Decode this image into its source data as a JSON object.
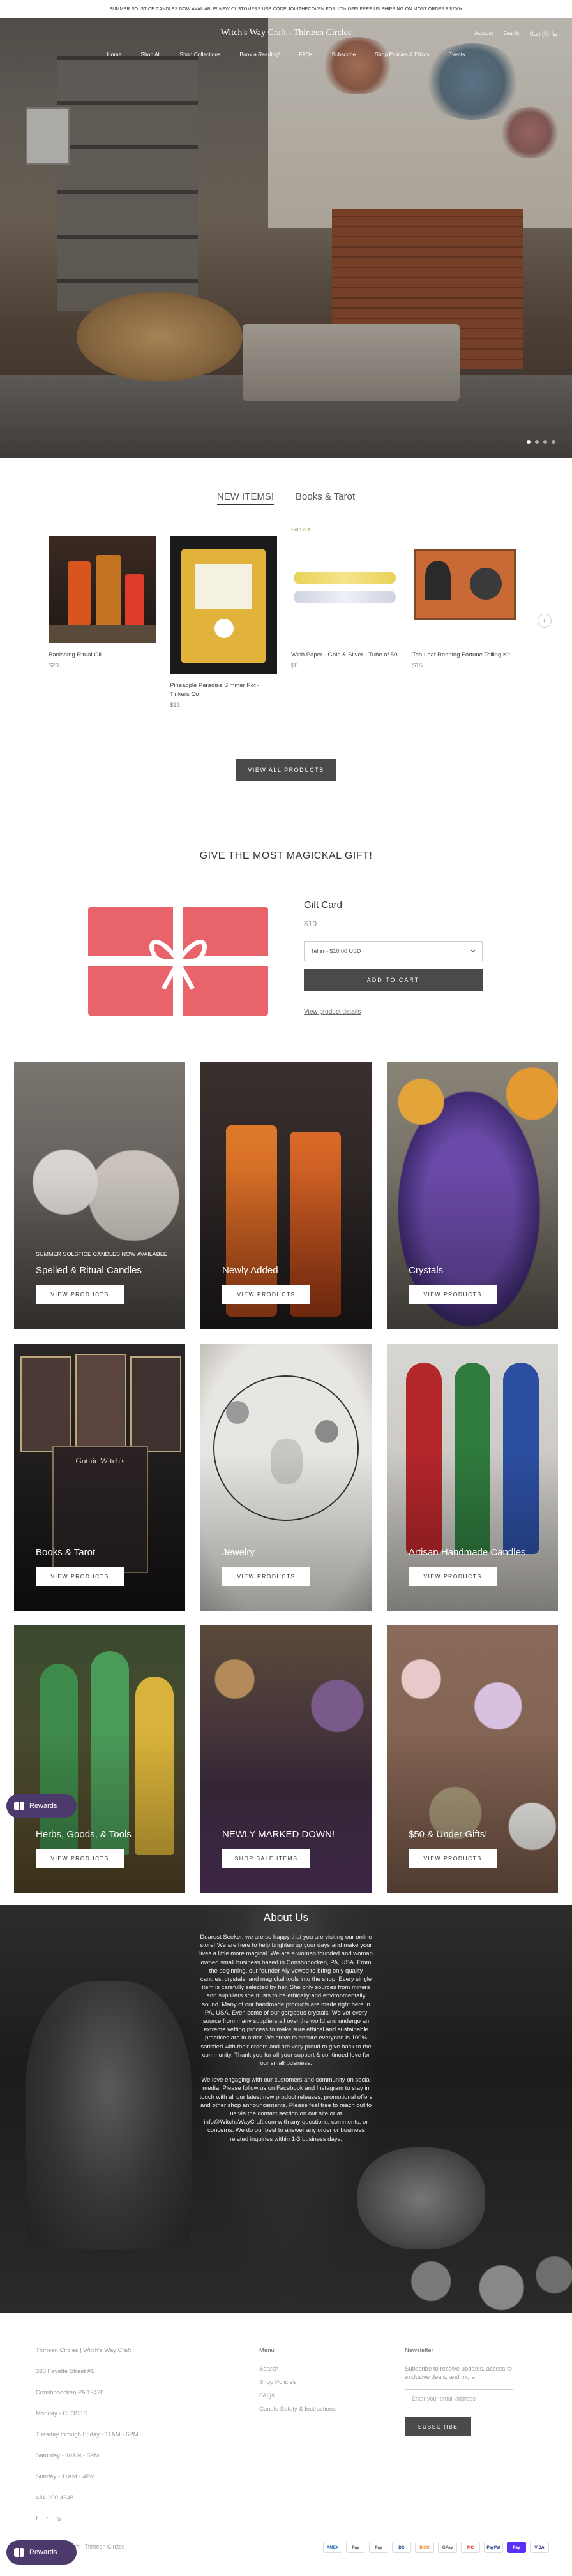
{
  "announcement": "SUMMER SOLSTICE CANDLES NOW AVAILABLE! NEW CUSTOMERS USE CODE JOINTHECOVEN FOR 10% OFF! FREE US SHIPPING ON MOST ORDERS $200+",
  "header": {
    "logo": "Witch's Way Craft - Thirteen Circles",
    "utility": {
      "account": "Account",
      "search": "Search",
      "cart": "Cart (0)"
    },
    "menu": [
      "Home",
      "Shop All",
      "Shop Collections",
      "Book a Reading!",
      "FAQs",
      "Subscribe",
      "Shop Policies & Ethics",
      "Events"
    ]
  },
  "hero": {
    "slides": 4,
    "active_slide": 0
  },
  "products_section": {
    "tabs": [
      "NEW ITEMS!",
      "Books & Tarot"
    ],
    "active_tab": 0,
    "items": [
      {
        "name": "Banishing Ritual Oil",
        "price": "$20",
        "tag": ""
      },
      {
        "name": "Pineapple Paradise Simmer Pot - Tinkers Co",
        "price": "$13",
        "tag": ""
      },
      {
        "name": "Wish Paper - Gold & Silver - Tube of 50",
        "price": "$8",
        "tag": "Sold out"
      },
      {
        "name": "Tea Leaf Reading Fortune Telling Kit",
        "price": "$15",
        "tag": ""
      }
    ],
    "next_arrow": "›",
    "view_all": "VIEW ALL PRODUCTS"
  },
  "gift": {
    "heading": "GIVE THE MOST MAGICKAL GIFT!",
    "title": "Gift Card",
    "price": "$10",
    "select_value": "Teller - $10.00 USD",
    "add_to_cart": "ADD TO CART",
    "view_details": "View product details"
  },
  "collections": [
    {
      "subtitle": "SUMMER SOLSTICE CANDLES NOW AVAILABLE",
      "title": "Spelled & Ritual Candles",
      "button": "VIEW PRODUCTS"
    },
    {
      "subtitle": "",
      "title": "Newly Added",
      "button": "VIEW PRODUCTS"
    },
    {
      "subtitle": "",
      "title": "Crystals",
      "button": "VIEW PRODUCTS"
    },
    {
      "subtitle": "",
      "title": "Books & Tarot",
      "button": "VIEW PRODUCTS"
    },
    {
      "subtitle": "",
      "title": "Jewelry",
      "button": "VIEW PRODUCTS"
    },
    {
      "subtitle": "",
      "title": "Artisan Handmade Candles",
      "button": "VIEW PRODUCTS"
    },
    {
      "subtitle": "",
      "title": "Herbs, Goods, & Tools",
      "button": "VIEW PRODUCTS"
    },
    {
      "subtitle": "",
      "title": "NEWLY MARKED DOWN!",
      "button": "SHOP SALE ITEMS"
    },
    {
      "subtitle": "",
      "title": "$50 & Under Gifts!",
      "button": "VIEW PRODUCTS"
    }
  ],
  "rewards_label": "Rewards",
  "about": {
    "heading": "About Us",
    "p1": "Dearest Seeker, we are so happy that you are visiting our online store! We are here to help brighten up your days and make your lives a little more magical. We are a woman founded and woman owned small business based in Conshohocken, PA, USA. From the beginning, our founder Aly vowed to bring only quality candles, crystals, and magickal tools into the shop. Every single item is carefully selected by her. She only sources from miners and suppliers she trusts to be ethically and environmentally sound. Many of our handmade products are made right here in PA, USA. Even some of our gorgeous crystals. We vet every source from many suppliers all over the world and undergo an extreme vetting process to make sure ethical and sustainable practices are in order. We strive to ensure everyone is 100% satisfied with their orders and are very proud to give back to the community. Thank you for all your support & continued love for our small business.",
    "p2": "We love engaging with our customers and community on social media. Please follow us on Facebook and Instagram to stay in touch with all our latest new product releases, promotional offers and other shop announcements. Please feel free to reach out to us via the contact section on our site or at info@WitchsWayCraft.com with any questions, comments, or concerns. We do our best to answer any order or business related inquiries within 1-3 business days."
  },
  "footer": {
    "address": {
      "name": "Thirteen Circles | Witch's Way Craft",
      "street": "320 Fayette Street #1",
      "city": "Conshohocken PA 19428",
      "monday": "Monday - CLOSED",
      "weekdays": "Tuesday through Friday - 11AM - 6PM",
      "saturday": "Saturday - 10AM - 5PM",
      "sunday": "Sunday - 11AM - 4PM",
      "phone": "484-200-4648"
    },
    "menu": {
      "heading": "Menu",
      "items": [
        "Search",
        "Shop Policies",
        "FAQs",
        "Candle Safety & Instructions"
      ]
    },
    "newsletter": {
      "heading": "Newsletter",
      "text": "Subscribe to receive updates, access to exclusive deals, and more.",
      "placeholder": "Enter your email address",
      "button": "SUBSCRIBE"
    },
    "social_icons": [
      "facebook-icon",
      "twitter-icon",
      "instagram-icon"
    ],
    "copyright": "© 2024 Witch's Way Craft - Thirteen Circles",
    "powered": "Powered by Shopify",
    "payments": [
      "AMEX",
      "Pay",
      "Pay",
      "DC",
      "DISC",
      "GPay",
      "MC",
      "PayPal",
      "Pay",
      "VISA"
    ]
  }
}
